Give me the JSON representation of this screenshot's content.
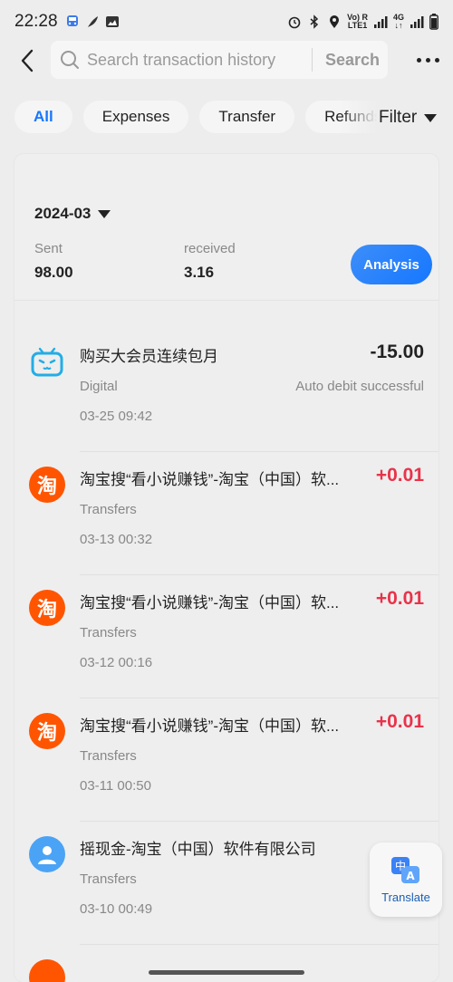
{
  "status_bar": {
    "time": "22:28",
    "network_top": "Vo) R",
    "network_bottom": "LTE1",
    "net2_top": "4G",
    "net2_bottom": "↓↑"
  },
  "header": {
    "search_placeholder": "Search transaction history",
    "search_button": "Search"
  },
  "tabs": [
    {
      "label": "All",
      "active": true
    },
    {
      "label": "Expenses",
      "active": false
    },
    {
      "label": "Transfer",
      "active": false
    },
    {
      "label": "Refunds",
      "active": false
    }
  ],
  "filter_label": "Filter",
  "summary": {
    "month": "2024-03",
    "sent_label": "Sent",
    "sent_value": "98.00",
    "received_label": "received",
    "received_value": "3.16",
    "analysis_button": "Analysis"
  },
  "transactions": [
    {
      "icon": "bilibili-icon",
      "title": "购买大会员连续包月",
      "amount": "-15.00",
      "category": "Digital",
      "status": "Auto debit successful",
      "time": "03-25 09:42"
    },
    {
      "icon": "taobao-icon",
      "title": "淘宝搜“看小说赚钱”-淘宝（中国）软...",
      "amount": "+0.01",
      "category": "Transfers",
      "status": "",
      "time": "03-13 00:32"
    },
    {
      "icon": "taobao-icon",
      "title": "淘宝搜“看小说赚钱”-淘宝（中国）软...",
      "amount": "+0.01",
      "category": "Transfers",
      "status": "",
      "time": "03-12 00:16"
    },
    {
      "icon": "taobao-icon",
      "title": "淘宝搜“看小说赚钱”-淘宝（中国）软...",
      "amount": "+0.01",
      "category": "Transfers",
      "status": "",
      "time": "03-11 00:50"
    },
    {
      "icon": "person-icon",
      "title": "摇现金-淘宝（中国）软件有限公司",
      "amount": "",
      "category": "Transfers",
      "status": "",
      "time": "03-10 00:49"
    }
  ],
  "taobao_glyph": "淘",
  "translate": {
    "label": "Translate",
    "glyph_zh": "中",
    "glyph_a": "A"
  },
  "colors": {
    "accent": "#1677ff",
    "positive_amount": "#e8334a",
    "taobao_orange": "#ff5500"
  }
}
